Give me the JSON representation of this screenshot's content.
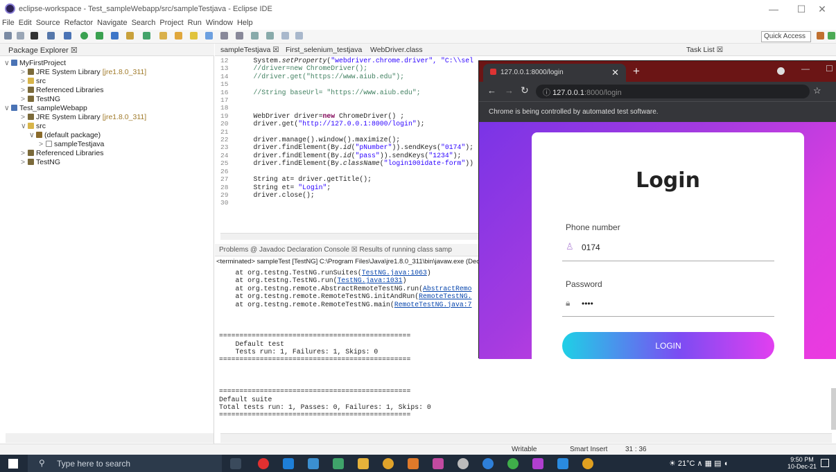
{
  "window": {
    "title": "eclipse-workspace - Test_sampleWebapp/src/sampleTestjava - Eclipse IDE",
    "minimize": "—",
    "maximize": "☐",
    "close": "✕"
  },
  "menu": [
    "File",
    "Edit",
    "Source",
    "Refactor",
    "Navigate",
    "Search",
    "Project",
    "Run",
    "Window",
    "Help"
  ],
  "toolbar": {
    "quick_access": "Quick Access"
  },
  "package_explorer": {
    "title": "Package Explorer ☒",
    "items": [
      {
        "arrow": "∨",
        "label": "MyFirstProject",
        "suffix": ""
      },
      {
        "arrow": ">",
        "label": "JRE System Library",
        "suffix": "[jre1.8.0_311]"
      },
      {
        "arrow": ">",
        "label": "src",
        "suffix": ""
      },
      {
        "arrow": ">",
        "label": "Referenced Libraries",
        "suffix": ""
      },
      {
        "arrow": ">",
        "label": "TestNG",
        "suffix": ""
      },
      {
        "arrow": "∨",
        "label": "Test_sampleWebapp",
        "suffix": ""
      },
      {
        "arrow": ">",
        "label": "JRE System Library",
        "suffix": "[jre1.8.0_311]"
      },
      {
        "arrow": "∨",
        "label": "src",
        "suffix": ""
      },
      {
        "arrow": "∨",
        "label": "(default package)",
        "suffix": ""
      },
      {
        "arrow": ">",
        "label": "sampleTestjava",
        "suffix": ""
      },
      {
        "arrow": ">",
        "label": "Referenced Libraries",
        "suffix": ""
      },
      {
        "arrow": ">",
        "label": "TestNG",
        "suffix": ""
      }
    ]
  },
  "editor": {
    "tabs": [
      "sampleTestjava ☒",
      "First_selenium_testjava",
      "WebDriver.class"
    ],
    "task_list": "Task List ☒",
    "line_numbers": [
      "12",
      "13",
      "14",
      "15",
      "16",
      "17",
      "18",
      "19",
      "20",
      "21",
      "22",
      "23",
      "24",
      "25",
      "26",
      "27",
      "28",
      "29",
      "30"
    ],
    "code": {
      "l12a": "System.",
      "l12b": "setProperty",
      "l12c": "(",
      "l12d": "\"webdriver.chrome.driver\", \"C:\\\\sel",
      "l13": "//driver=new ChromeDriver();",
      "l14": "//driver.get(\"https://www.aiub.edu\");",
      "l16": "//String baseUrl= \"https://www.aiub.edu\";",
      "l19a": "WebDriver driver=",
      "l19b": "new",
      "l19c": " ChromeDriver() ;",
      "l20a": "driver.get(",
      "l20b": "\"http://127.0.0.1:8000/login\"",
      "l20c": ");",
      "l22": "driver.manage().window().maximize();",
      "l23a": "driver.findElement(By.",
      "l23b": "id",
      "l23c": "(",
      "l23d": "\"pNumber\"",
      "l23e": ")).sendKeys(",
      "l23f": "\"0174\"",
      "l23g": ");",
      "l24a": "driver.findElement(By.",
      "l24b": "id",
      "l24c": "(",
      "l24d": "\"pass\"",
      "l24e": ")).sendKeys(",
      "l24f": "\"1234\"",
      "l24g": ");",
      "l25a": "driver.findElement(By.",
      "l25b": "className",
      "l25c": "(",
      "l25d": "\"login100idate-form\"",
      "l25e": "))",
      "l27": "String at= driver.getTitle();",
      "l28a": "String et= ",
      "l28b": "\"Login\"",
      "l28c": ";",
      "l29": "driver.close();"
    }
  },
  "console": {
    "tabs": "Problems  @ Javadoc  Declaration  Console ☒  Results of running class samp",
    "terminated": "<terminated> sampleTest [TestNG] C:\\Program Files\\Java\\jre1.8.0_311\\bin\\javaw.exe (Dec",
    "stack": [
      {
        "pre": "    at org.testng.TestNG.runSuites(",
        "link": "TestNG.java:1063",
        "post": ")"
      },
      {
        "pre": "    at org.testng.TestNG.run(",
        "link": "TestNG.java:1031",
        "post": ")"
      },
      {
        "pre": "    at org.testng.remote.AbstractRemoteTestNG.run(",
        "link": "AbstractRemo",
        "post": ""
      },
      {
        "pre": "    at org.testng.remote.RemoteTestNG.initAndRun(",
        "link": "RemoteTestNG.",
        "post": ""
      },
      {
        "pre": "    at org.testng.remote.RemoteTestNG.main(",
        "link": "RemoteTestNG.java:7",
        "post": ""
      }
    ],
    "sep": "===============================================",
    "default_test": "    Default test",
    "tests_run": "    Tests run: 1, Failures: 1, Skips: 0",
    "default_suite": "Default suite",
    "total": "Total tests run: 1, Passes: 0, Failures: 1, Skips: 0"
  },
  "status": {
    "writable": "Writable",
    "insert": "Smart Insert",
    "pos": "31 : 36"
  },
  "browser": {
    "tab_title": "127.0.0.1:8000/login",
    "url_host": "127.0.0.1",
    "url_rest": ":8000/login",
    "infobar": "Chrome is being controlled by automated test software.",
    "form": {
      "heading": "Login",
      "phone_label": "Phone number",
      "phone_value": "0174",
      "password_label": "Password",
      "password_value": "••••",
      "button": "LOGIN"
    }
  },
  "taskbar": {
    "search": "Type here to search",
    "weather": "21°C",
    "time": "9:50 PM",
    "date": "10-Dec-21"
  }
}
